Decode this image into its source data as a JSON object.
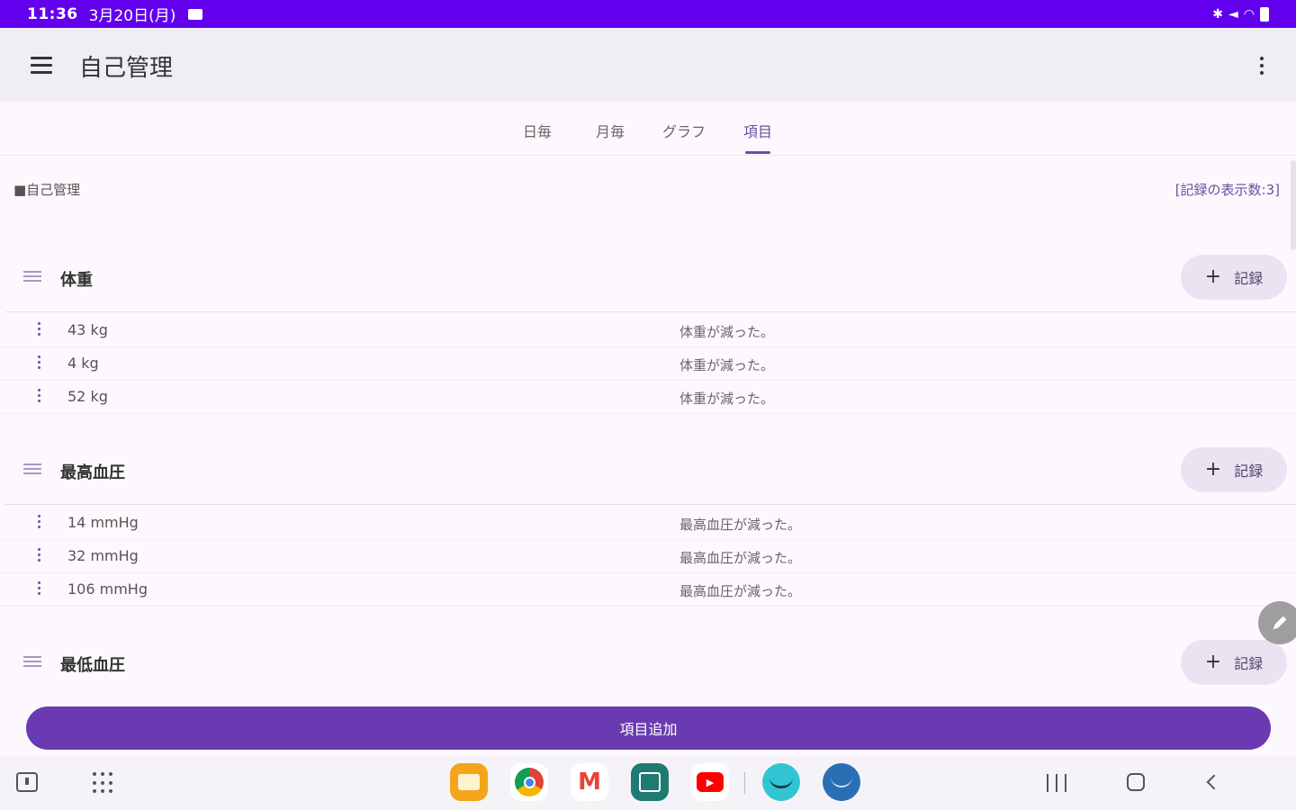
{
  "status_bar": {
    "time": "11:36",
    "date": "3月20日(月)"
  },
  "app_bar": {
    "title": "自己管理"
  },
  "tabs": [
    {
      "label": "日毎",
      "active": false
    },
    {
      "label": "月毎",
      "active": false
    },
    {
      "label": "グラフ",
      "active": false
    },
    {
      "label": "項目",
      "active": true
    }
  ],
  "content": {
    "section_title": "■自己管理",
    "record_count": "[記録の表示数:3]",
    "add_record_label": "記録",
    "groups": [
      {
        "title": "体重",
        "rows": [
          {
            "value": "43 kg",
            "note": "体重が減った。"
          },
          {
            "value": "4 kg",
            "note": "体重が減った。"
          },
          {
            "value": "52 kg",
            "note": "体重が減った。"
          }
        ]
      },
      {
        "title": "最高血圧",
        "rows": [
          {
            "value": "14 mmHg",
            "note": "最高血圧が減った。"
          },
          {
            "value": "32 mmHg",
            "note": "最高血圧が減った。"
          },
          {
            "value": "106 mmHg",
            "note": "最高血圧が減った。"
          }
        ]
      },
      {
        "title": "最低血圧",
        "rows": []
      }
    ],
    "add_item_button": "項目追加"
  },
  "dock_apps": [
    {
      "name": "my-files-icon",
      "color": "#f4a51c"
    },
    {
      "name": "chrome-icon",
      "color": "#ffffff"
    },
    {
      "name": "gmail-icon",
      "color": "#ffffff"
    },
    {
      "name": "calendar-icon",
      "color": "#1f7a72"
    },
    {
      "name": "youtube-icon",
      "color": "#ffffff"
    },
    {
      "name": "amazon-shopping-icon",
      "color": "#31c5d3"
    },
    {
      "name": "prime-video-icon",
      "color": "#2a6fb4"
    }
  ],
  "colors": {
    "status_bar": "#6200ee",
    "accent": "#6750a4",
    "add_item_button": "#6a3ab2"
  }
}
